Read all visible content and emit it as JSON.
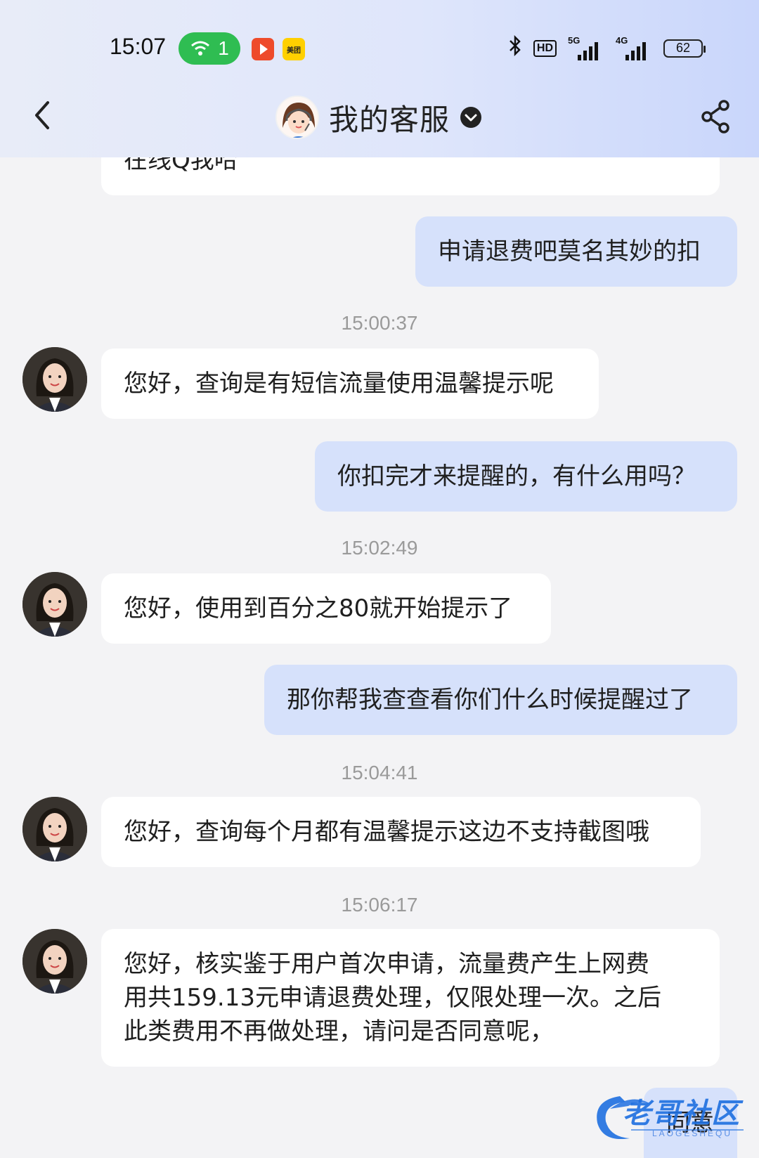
{
  "status_bar": {
    "time": "15:07",
    "hotspot_count": "1",
    "meituan_label": "美团",
    "hd_label": "HD",
    "net1": "5G",
    "net2": "4G",
    "battery": "62"
  },
  "header": {
    "title": "我的客服"
  },
  "messages": {
    "partial_top": "在线Q我哈",
    "m1": "申请退费吧莫名其妙的扣",
    "t1": "15:00:37",
    "m2": "您好，查询是有短信流量使用温馨提示呢",
    "m3": "你扣完才来提醒的，有什么用吗？",
    "t2": "15:02:49",
    "m4": "您好，使用到百分之80就开始提示了",
    "m5": "那你帮我查查看你们什么时候提醒过了",
    "t3": "15:04:41",
    "m6": "您好，查询每个月都有温馨提示这边不支持截图哦",
    "t4": "15:06:17",
    "m7_line1": "您好，核实鉴于用户首次申请，流量费产生上网费",
    "m7_line2": "用共159.13元申请退费处理，仅限处理一次。之后",
    "m7_line3": "此类费用不再做处理，请问是否同意呢，",
    "m8": "同意"
  },
  "watermark": {
    "text": "老哥社区",
    "sub": "LAOGESHEQU"
  },
  "colors": {
    "incoming_bubble": "#ffffff",
    "outgoing_bubble": "#d6e1fb",
    "background": "#f3f3f5",
    "hotspot": "#2fbd52"
  }
}
